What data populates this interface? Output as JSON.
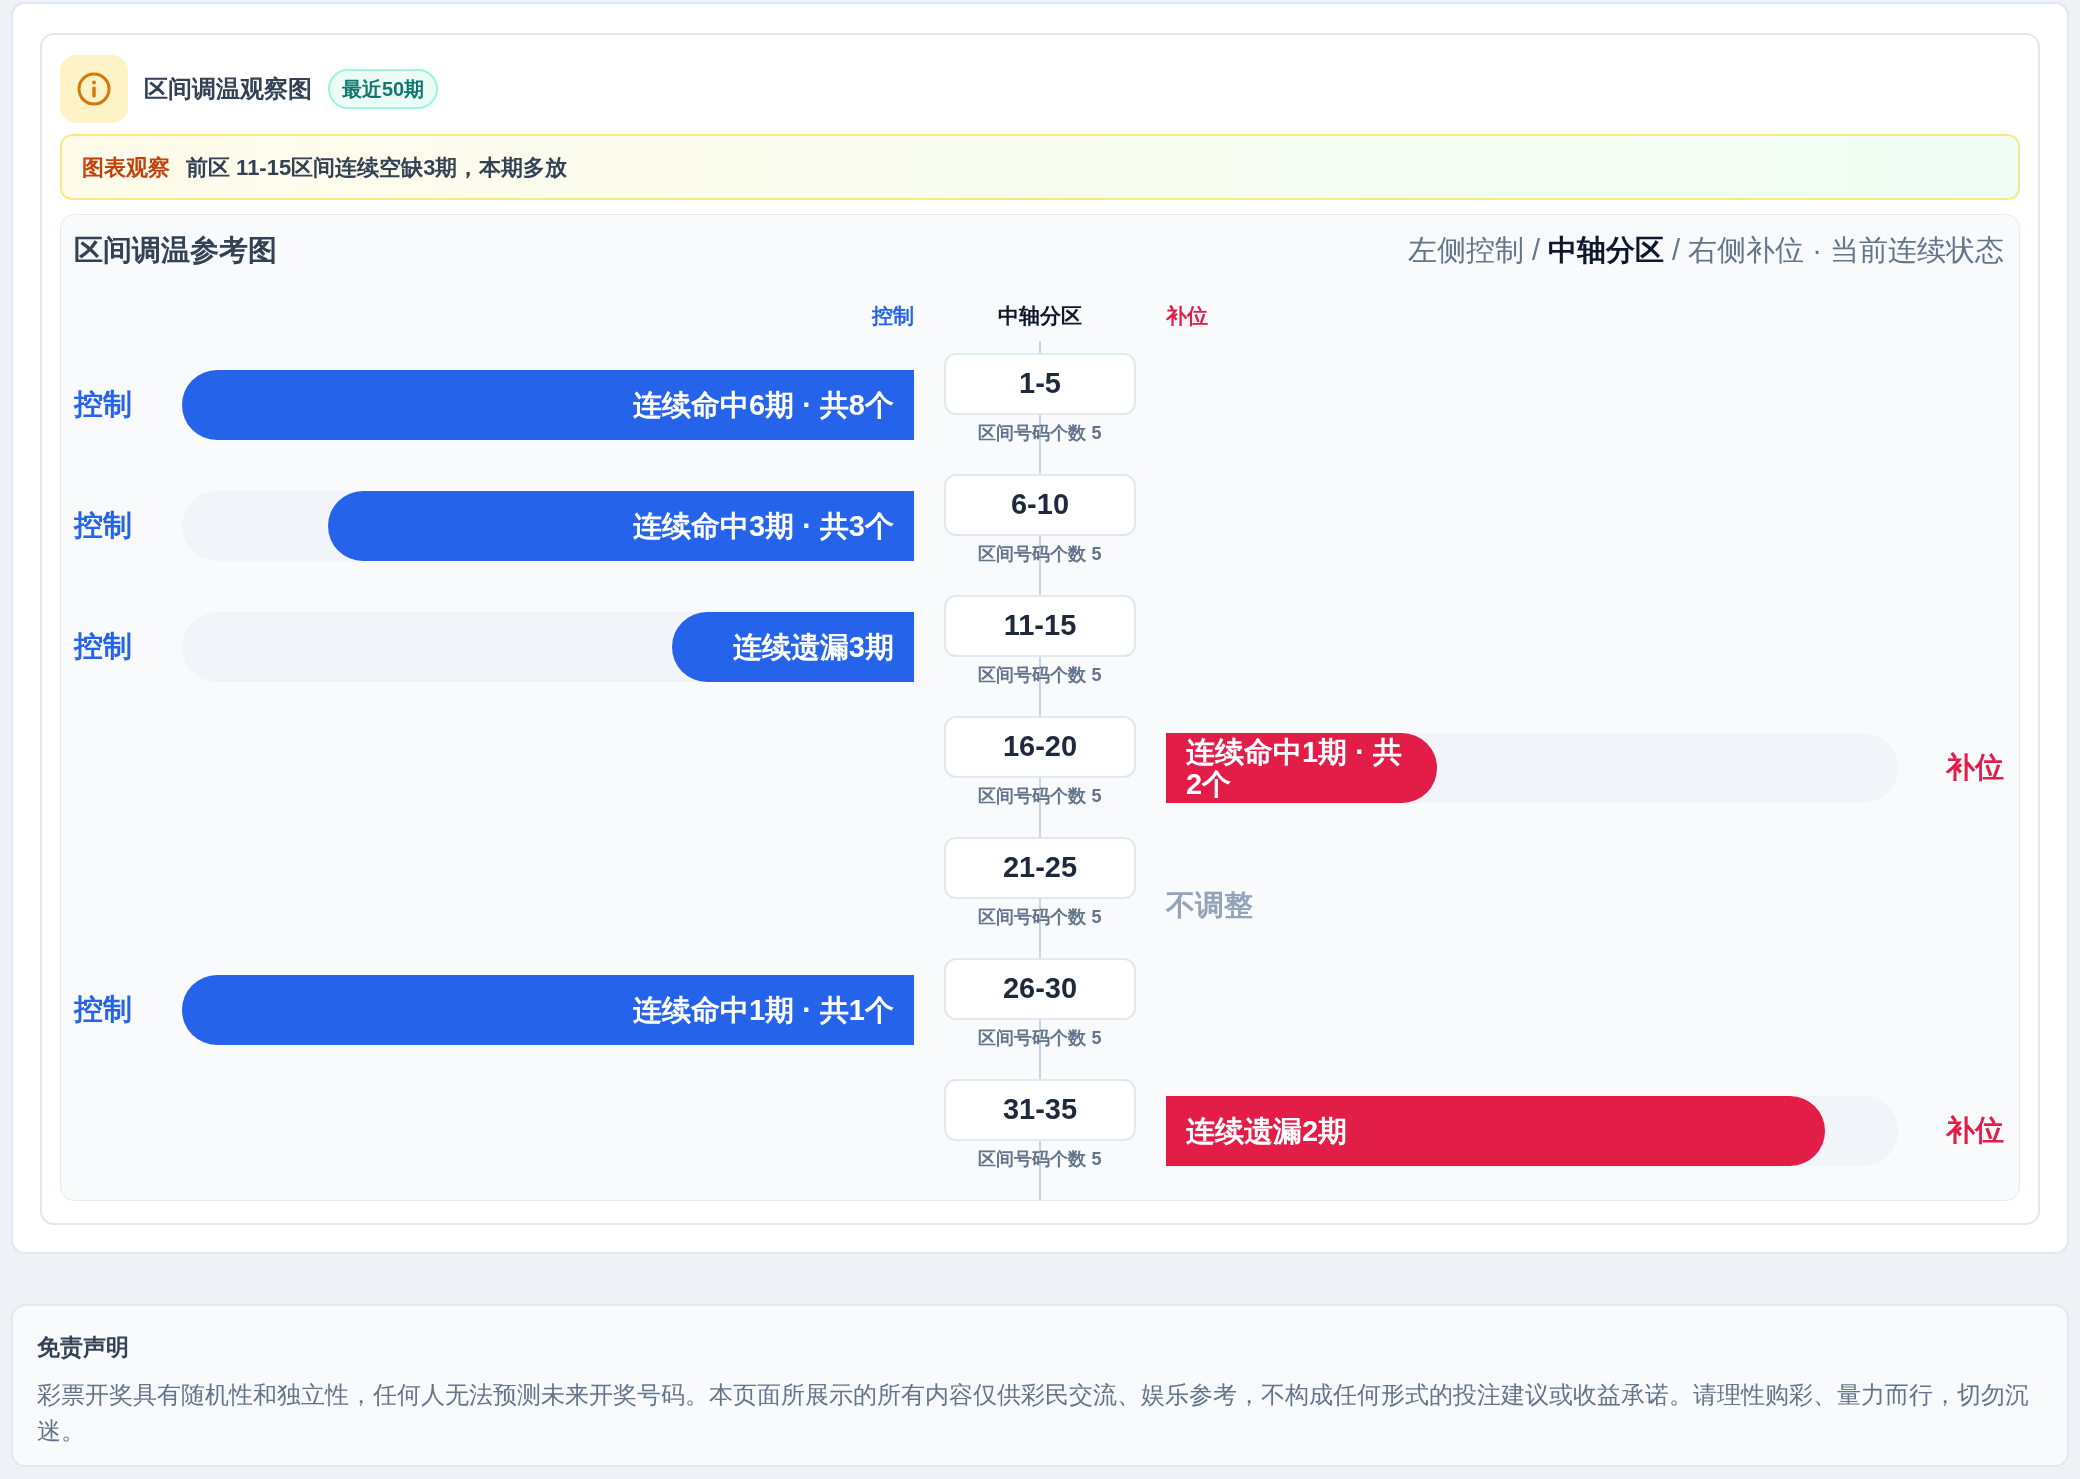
{
  "header": {
    "title": "区间调温观察图",
    "badge": "最近50期"
  },
  "observation": {
    "label": "图表观察",
    "text": "前区 11-15区间连续空缺3期，本期多放"
  },
  "chart": {
    "title": "区间调温参考图",
    "legend": "左侧控制 / **中轴分区** / 右侧补位 · 当前连续状态",
    "columns": {
      "left": "控制",
      "center": "中轴分区",
      "right": "补位"
    },
    "rows": [
      {
        "range": "1-5",
        "count_label": "区间号码个数 5",
        "kind": "control",
        "side_label": "控制",
        "bar_text": "连续命中6期 · 共8个",
        "level": 1.0
      },
      {
        "range": "6-10",
        "count_label": "区间号码个数 5",
        "kind": "control",
        "side_label": "控制",
        "bar_text": "连续命中3期 · 共3个",
        "level": 0.8
      },
      {
        "range": "11-15",
        "count_label": "区间号码个数 5",
        "kind": "control",
        "side_label": "控制",
        "bar_text": "连续遗漏3期",
        "level": 0.33
      },
      {
        "range": "16-20",
        "count_label": "区间号码个数 5",
        "kind": "fill",
        "side_label": "补位",
        "bar_text": "连续命中1期 · 共2个",
        "level": 0.37
      },
      {
        "range": "21-25",
        "count_label": "区间号码个数 5",
        "kind": "none",
        "note": "不调整"
      },
      {
        "range": "26-30",
        "count_label": "区间号码个数 5",
        "kind": "control",
        "side_label": "控制",
        "bar_text": "连续命中1期 · 共1个",
        "level": 1.0
      },
      {
        "range": "31-35",
        "count_label": "区间号码个数 5",
        "kind": "fill",
        "side_label": "补位",
        "bar_text": "连续遗漏2期",
        "level": 0.9
      }
    ]
  },
  "disclaimer": {
    "title": "免责声明",
    "text": "彩票开奖具有随机性和独立性，任何人无法预测未来开奖号码。本页面所展示的所有内容仅供彩民交流、娱乐参考，不构成任何形式的投注建议或收益承诺。请理性购彩、量力而行，切勿沉迷。"
  }
}
